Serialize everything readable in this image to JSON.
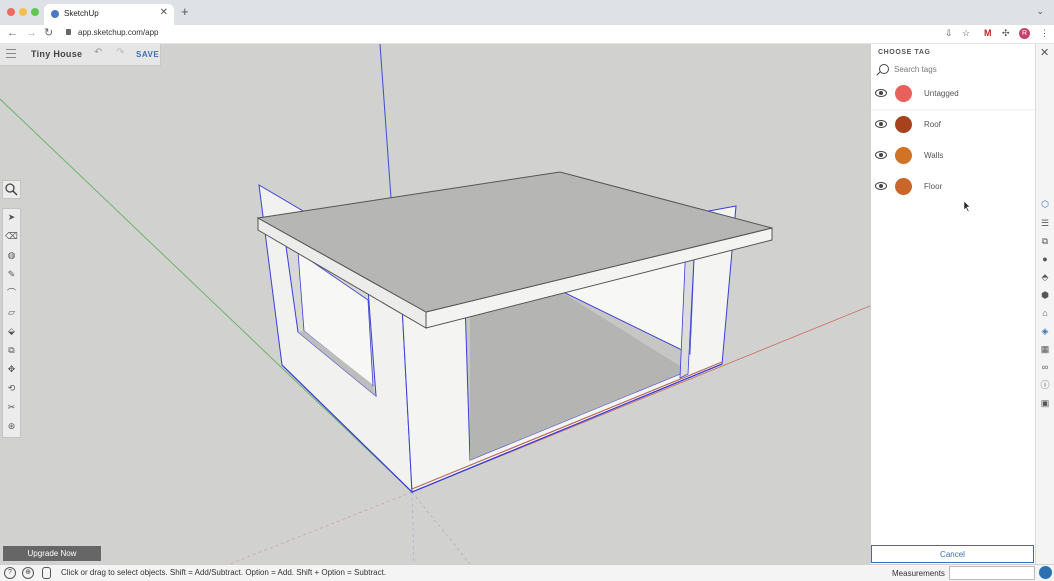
{
  "browser": {
    "tab_title": "SketchUp",
    "url": "app.sketchup.com/app",
    "profile_initial": "R",
    "traffic_colors": [
      "#ec6a5e",
      "#f5bf4f",
      "#61c554"
    ]
  },
  "app": {
    "model_title": "Tiny House",
    "save_label": "SAVE",
    "upgrade_label": "Upgrade Now"
  },
  "toolbar": {
    "tools": [
      "select-icon",
      "eraser-icon",
      "paint-bucket-icon",
      "pencil-line-icon",
      "arc-icon",
      "rectangle-icon",
      "push-pull-icon",
      "offset-icon",
      "move-icon",
      "rotate-icon",
      "tape-measure-icon",
      "orbit-icon"
    ]
  },
  "tag_panel": {
    "title": "CHOOSE TAG",
    "search_placeholder": "Search tags",
    "tags": [
      {
        "name": "Untagged",
        "color": "#e8615d"
      },
      {
        "name": "Roof",
        "color": "#a7431c"
      },
      {
        "name": "Walls",
        "color": "#cf7326"
      },
      {
        "name": "Floor",
        "color": "#c9672a"
      }
    ],
    "cancel_label": "Cancel"
  },
  "status": {
    "hint": "Click or drag to select objects. Shift = Add/Subtract. Option = Add. Shift + Option = Subtract.",
    "measurements_label": "Measurements"
  },
  "colors": {
    "accent": "#3b6fb5",
    "axis_green": "#6fb36a",
    "axis_red": "#c96b63",
    "axis_blue": "#3b4fd0",
    "edge_blue": "#3a3fd4"
  }
}
